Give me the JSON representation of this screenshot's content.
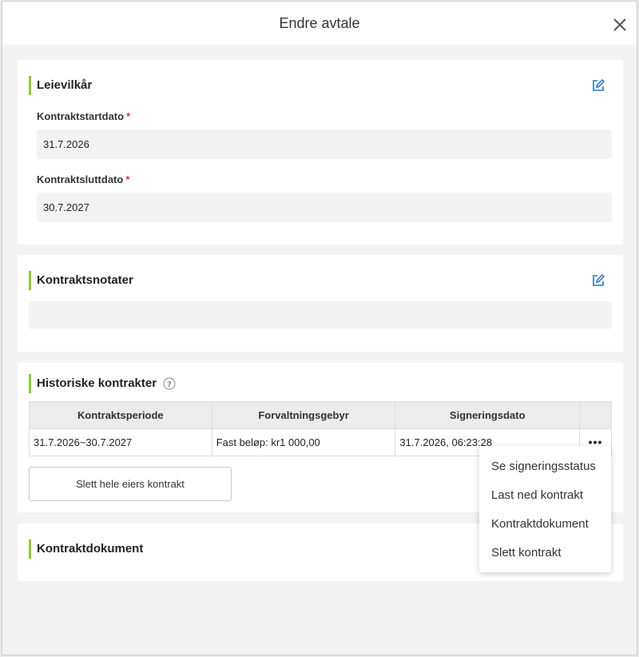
{
  "modal": {
    "title": "Endre avtale"
  },
  "lease_terms": {
    "title": "Leievilkår",
    "start_label": "Kontraktstartdato",
    "start_value": "31.7.2026",
    "end_label": "Kontraktsluttdato",
    "end_value": "30.7.2027",
    "required_mark": "*"
  },
  "notes": {
    "title": "Kontraktsnotater",
    "value": ""
  },
  "history": {
    "title": "Historiske kontrakter",
    "columns": [
      "Kontraktsperiode",
      "Forvaltningsgebyr",
      "Signeringsdato"
    ],
    "rows": [
      {
        "period": "31.7.2026~30.7.2027",
        "fee": "Fast beløp: kr1 000,00",
        "signed": "31.7.2026, 06:23:28"
      }
    ],
    "more_label": "•••",
    "delete_button": "Slett hele eiers kontrakt"
  },
  "menu": {
    "items": [
      "Se signeringsstatus",
      "Last ned kontrakt",
      "Kontraktdokument",
      "Slett kontrakt"
    ]
  },
  "document": {
    "title": "Kontraktdokument"
  },
  "colors": {
    "accent": "#8cc63f",
    "edit_icon": "#2a72c9",
    "required": "#d9363e"
  },
  "icons": [
    "close-icon",
    "edit-icon",
    "help-icon",
    "more-icon"
  ]
}
